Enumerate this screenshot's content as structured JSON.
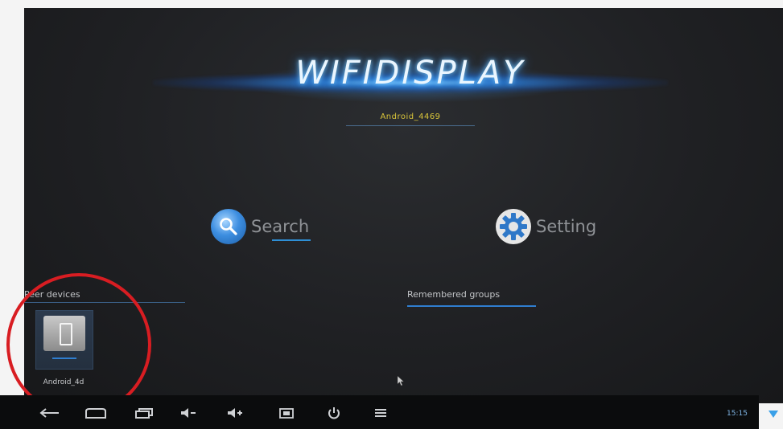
{
  "app": {
    "logo_text": "WIFIDISPLAY",
    "device_name": "Android_4469"
  },
  "actions": {
    "search_label": "Search",
    "setting_label": "Setting"
  },
  "sections": {
    "peer_devices": "Peer devices",
    "remembered_groups": "Remembered groups"
  },
  "peer_devices": [
    {
      "label": "Android_4d"
    }
  ],
  "status_bar": {
    "time": "15:15"
  },
  "colors": {
    "accent": "#2f7ed0",
    "annotation": "#d81d22",
    "device_name": "#d8c43a"
  }
}
